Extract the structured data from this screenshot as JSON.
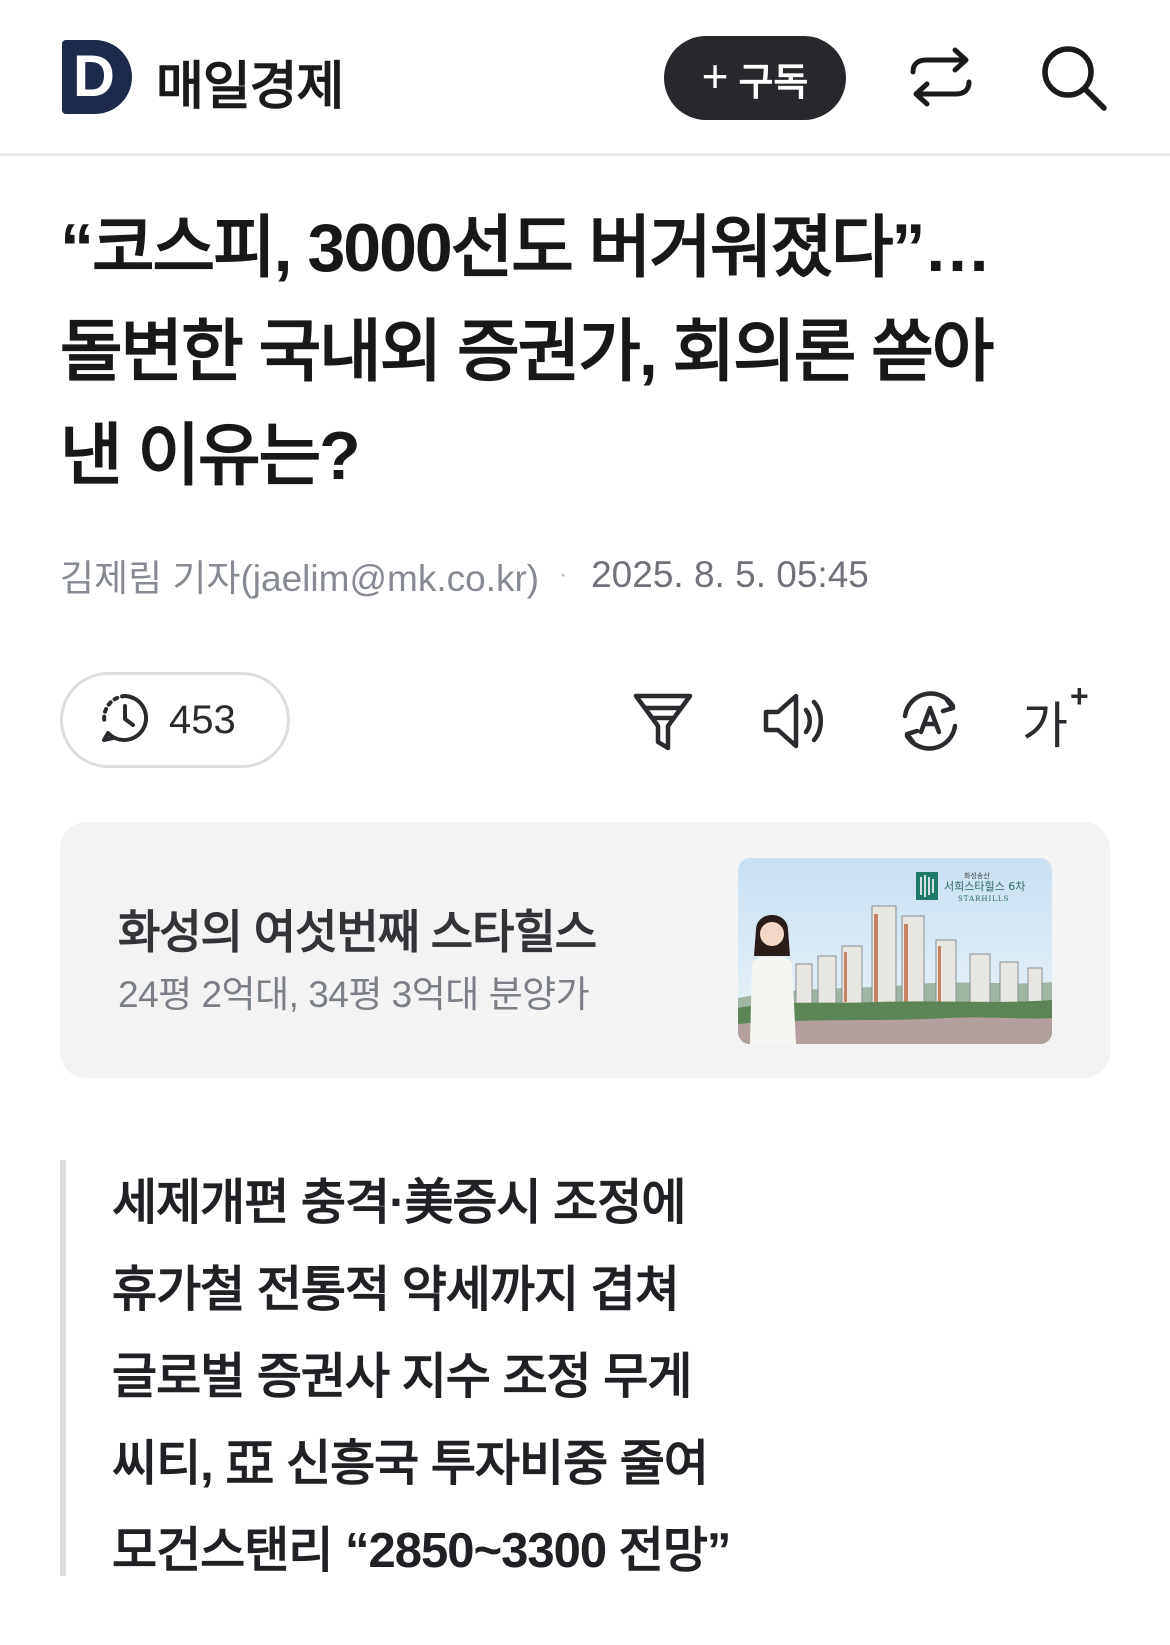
{
  "header": {
    "logo_letter": "D",
    "brand_name": "매일경제",
    "subscribe_plus": "+",
    "subscribe_label": "구독"
  },
  "article": {
    "headline_lines": [
      "“코스피, 3000선도 버거워졌다”…",
      "돌변한 국내외 증권가, 회의론 쏟아",
      "낸 이유는?"
    ],
    "author": "김제림 기자(jaelim@mk.co.kr)",
    "separator": "·",
    "published": "2025. 8. 5. 05:45",
    "comment_count": "453"
  },
  "toolbar": {
    "font_size_label": "가",
    "font_size_plus": "+"
  },
  "ad": {
    "title": "화성의 여섯번째 스타힐스",
    "subtitle": "24평 2억대, 34평 3억대 분양가",
    "image_brand_top": "화성송산",
    "image_brand_main": "서희스타힐스 6차",
    "image_brand_en": "STARHILLS"
  },
  "summary": [
    "세제개편 충격·美증시 조정에",
    "휴가철 전통적 약세까지 겹쳐",
    "글로벌 증권사 지수 조정 무게",
    "씨티, 亞 신흥국 투자비중 줄여",
    "모건스탠리 “2850~3300 전망”"
  ],
  "colors": {
    "brand_navy": "#1d2a4a",
    "subscribe_bg": "#26282c",
    "ad_bg": "#f3f3f4",
    "summary_bar": "#dadbdf"
  }
}
